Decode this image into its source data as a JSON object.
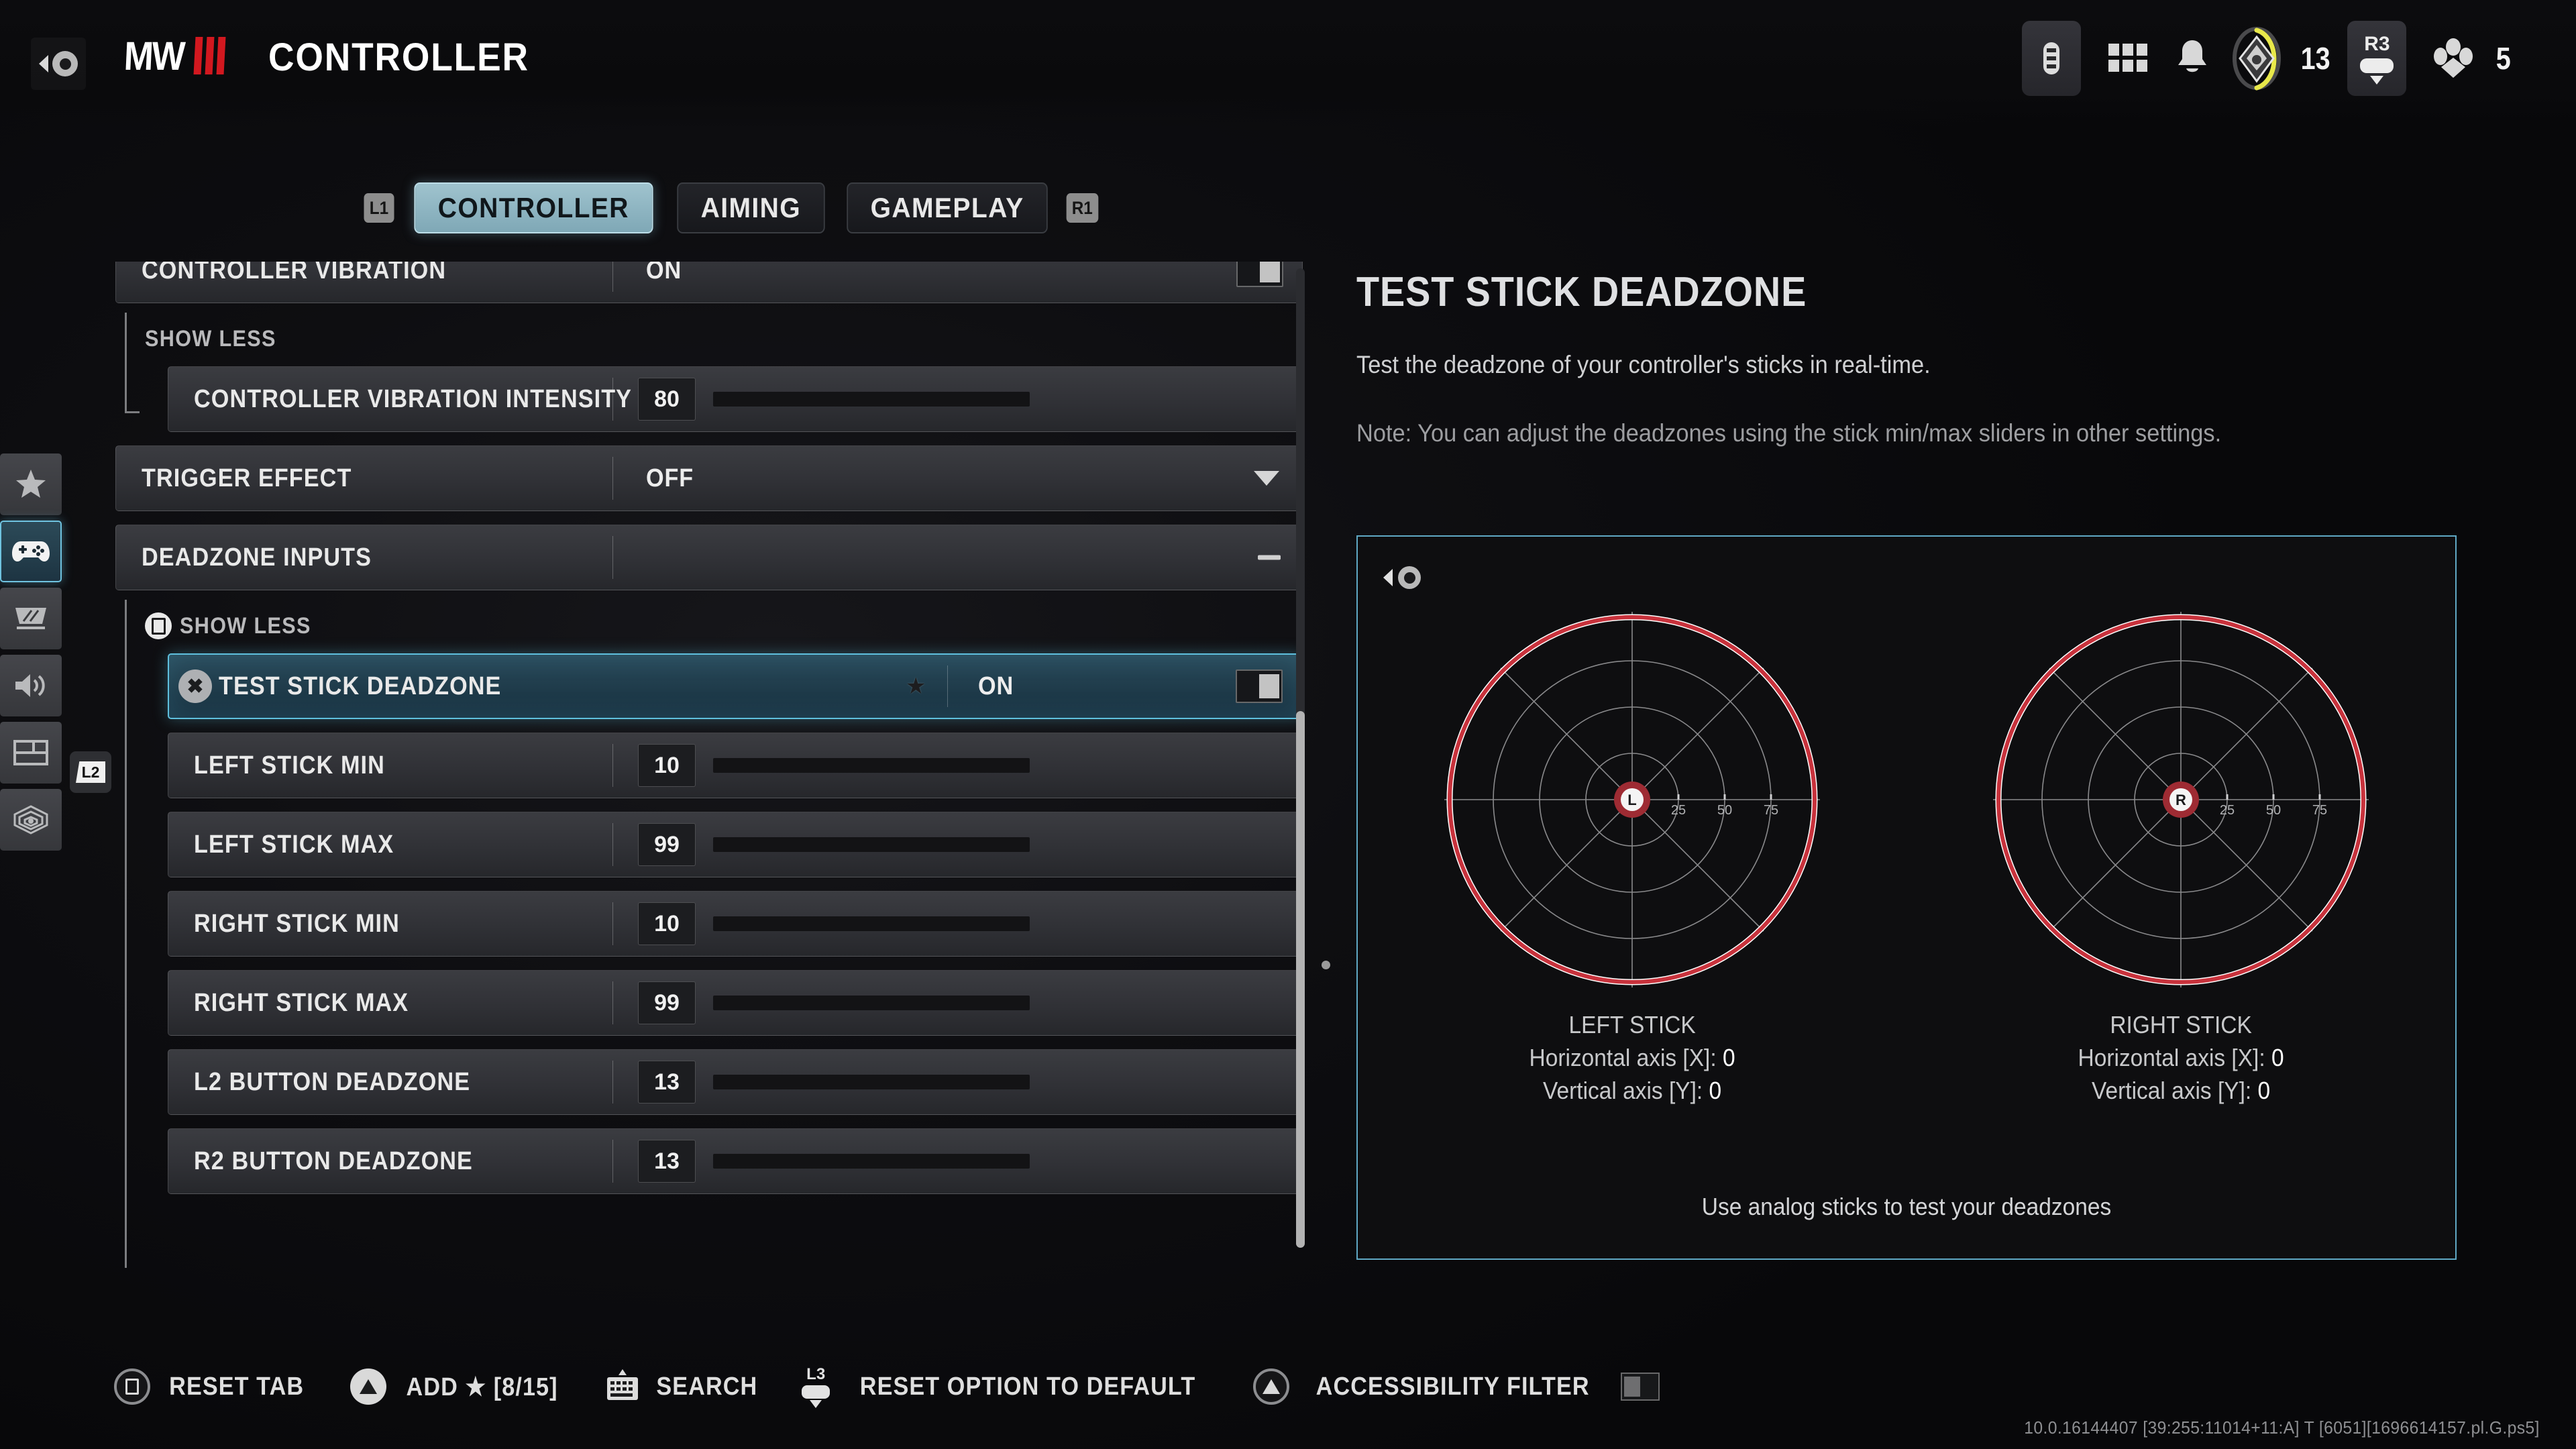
{
  "header": {
    "back_icon": "circle-button-back-icon",
    "logo_text": "MW",
    "title": "CONTROLLER",
    "right_icons": [
      {
        "name": "battery-icon",
        "label": ""
      },
      {
        "name": "grid-menu-icon",
        "label": ""
      },
      {
        "name": "bell-notification-icon",
        "label": ""
      },
      {
        "name": "rank-emblem-icon",
        "label": "13"
      },
      {
        "name": "r3-stick-button-icon",
        "label": "R3"
      },
      {
        "name": "squad-members-icon",
        "label": "5"
      }
    ],
    "rank_value": "13",
    "squad_value": "5",
    "r3_badge": "R3",
    "accent_yellow": "#e8e84a"
  },
  "tabs": {
    "left_badge": "L1",
    "right_badge": "R1",
    "items": [
      {
        "label": "CONTROLLER",
        "active": true
      },
      {
        "label": "AIMING",
        "active": false
      },
      {
        "label": "GAMEPLAY",
        "active": false
      }
    ],
    "active_color": "#9fc3ce"
  },
  "sidebar": {
    "items": [
      {
        "name": "sidebar-item-favorites",
        "icon": "star-icon",
        "active": false
      },
      {
        "name": "sidebar-item-controller",
        "icon": "gamepad-icon",
        "active": true
      },
      {
        "name": "sidebar-item-graphics",
        "icon": "display-icon",
        "active": false
      },
      {
        "name": "sidebar-item-audio",
        "icon": "speaker-icon",
        "active": false
      },
      {
        "name": "sidebar-item-interface",
        "icon": "layout-icon",
        "active": false
      },
      {
        "name": "sidebar-item-account",
        "icon": "network-icon",
        "active": false
      }
    ],
    "l2_badge": "L2"
  },
  "settings": {
    "rows": [
      {
        "label": "CONTROLLER VIBRATION",
        "value": "ON",
        "control": "toggle",
        "toggle_on": true,
        "indent": false,
        "selected": false
      },
      {
        "label": "CONTROLLER VIBRATION INTENSITY",
        "value": "80",
        "control": "slider",
        "percent": 80,
        "indent": true,
        "selected": false
      },
      {
        "label": "TRIGGER EFFECT",
        "value": "OFF",
        "control": "dropdown",
        "indent": false,
        "selected": false
      },
      {
        "label": "DEADZONE INPUTS",
        "value": "",
        "control": "collapse",
        "indent": false,
        "selected": false
      },
      {
        "label": "TEST STICK DEADZONE",
        "value": "ON",
        "control": "toggle",
        "toggle_on": true,
        "indent": true,
        "selected": true,
        "starred": true
      },
      {
        "label": "LEFT STICK MIN",
        "value": "10",
        "control": "slider",
        "percent": 10,
        "indent": true,
        "selected": false
      },
      {
        "label": "LEFT STICK MAX",
        "value": "99",
        "control": "slider",
        "percent": 99,
        "indent": true,
        "selected": false
      },
      {
        "label": "RIGHT STICK MIN",
        "value": "10",
        "control": "slider",
        "percent": 10,
        "indent": true,
        "selected": false
      },
      {
        "label": "RIGHT STICK MAX",
        "value": "99",
        "control": "slider",
        "percent": 99,
        "indent": true,
        "selected": false
      },
      {
        "label": "L2 BUTTON DEADZONE",
        "value": "13",
        "control": "slider",
        "percent": 13,
        "indent": true,
        "selected": false
      },
      {
        "label": "R2 BUTTON DEADZONE",
        "value": "13",
        "control": "slider",
        "percent": 13,
        "indent": true,
        "selected": false
      }
    ],
    "show_less_1": "SHOW LESS",
    "show_less_2": "SHOW LESS"
  },
  "detail": {
    "title": "TEST STICK DEADZONE",
    "description": "Test the deadzone of your controller's sticks in real-time.",
    "note": "Note: You can adjust the deadzones using the stick min/max sliders in other settings.",
    "back_icon": "circle-button-back-icon",
    "hint": "Use analog sticks to test your deadzones",
    "border_color": "#5fa8c4"
  },
  "chart_data": {
    "type": "scatter",
    "title": "Stick Deadzone Visualizer",
    "ring_color": "#c8323c",
    "grid_color": "#8a8a8c",
    "tick_labels": [
      "25",
      "50",
      "75"
    ],
    "radial_ticks": [
      25,
      50,
      75
    ],
    "axis_range": [
      -100,
      100
    ],
    "spokes": 8,
    "sticks": [
      {
        "id": "L",
        "name": "LEFT STICK",
        "center_label": "L",
        "x_label": "Horizontal axis [X]:",
        "x_value": "0",
        "y_label": "Vertical axis [Y]:",
        "y_value": "0",
        "inner_deadzone": 10,
        "outer_deadzone": 99,
        "position": {
          "x": 0,
          "y": 0
        }
      },
      {
        "id": "R",
        "name": "RIGHT STICK",
        "center_label": "R",
        "x_label": "Horizontal axis [X]:",
        "x_value": "0",
        "y_label": "Vertical axis [Y]:",
        "y_value": "0",
        "inner_deadzone": 10,
        "outer_deadzone": 99,
        "position": {
          "x": 0,
          "y": 0
        }
      }
    ]
  },
  "bottombar": {
    "items": [
      {
        "icon": "square-button-icon",
        "label": "RESET TAB"
      },
      {
        "icon": "triangle-button-icon",
        "label": "ADD ★ [8/15]"
      },
      {
        "icon": "keyboard-icon",
        "label": "SEARCH"
      },
      {
        "icon": "l3-stick-icon",
        "label": "RESET OPTION TO DEFAULT"
      },
      {
        "icon": "triangle-button-icon",
        "label": "ACCESSIBILITY FILTER"
      }
    ],
    "accessibility_toggle_on": false
  },
  "version": "10.0.16144407 [39:255:11014+11:A] T [6051][1696614157.pl.G.ps5]"
}
